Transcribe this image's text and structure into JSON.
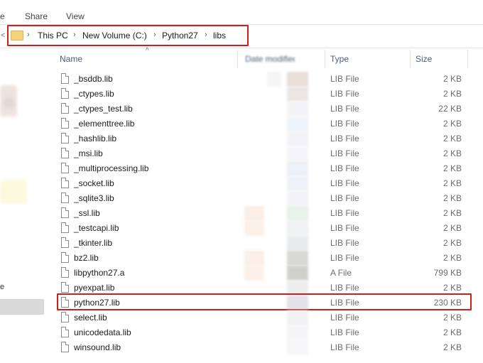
{
  "ribbon": {
    "tab_partial": "e",
    "share": "Share",
    "view": "View"
  },
  "address": {
    "crumbs": [
      "This PC",
      "New Volume (C:)",
      "Python27",
      "libs"
    ],
    "separator": "›",
    "nav_arrow": "<"
  },
  "nav_pane": {
    "partial_label": "e"
  },
  "columns": {
    "name": "Name",
    "date": "Date modified",
    "type": "Type",
    "size": "Size",
    "sort_caret": "^"
  },
  "files": [
    {
      "name": "_bsddb.lib",
      "type": "LIB File",
      "size": "2 KB"
    },
    {
      "name": "_ctypes.lib",
      "type": "LIB File",
      "size": "2 KB"
    },
    {
      "name": "_ctypes_test.lib",
      "type": "LIB File",
      "size": "22 KB"
    },
    {
      "name": "_elementtree.lib",
      "type": "LIB File",
      "size": "2 KB"
    },
    {
      "name": "_hashlib.lib",
      "type": "LIB File",
      "size": "2 KB"
    },
    {
      "name": "_msi.lib",
      "type": "LIB File",
      "size": "2 KB"
    },
    {
      "name": "_multiprocessing.lib",
      "type": "LIB File",
      "size": "2 KB"
    },
    {
      "name": "_socket.lib",
      "type": "LIB File",
      "size": "2 KB"
    },
    {
      "name": "_sqlite3.lib",
      "type": "LIB File",
      "size": "2 KB"
    },
    {
      "name": "_ssl.lib",
      "type": "LIB File",
      "size": "2 KB"
    },
    {
      "name": "_testcapi.lib",
      "type": "LIB File",
      "size": "2 KB"
    },
    {
      "name": "_tkinter.lib",
      "type": "LIB File",
      "size": "2 KB"
    },
    {
      "name": "bz2.lib",
      "type": "LIB File",
      "size": "2 KB"
    },
    {
      "name": "libpython27.a",
      "type": "A File",
      "size": "799 KB"
    },
    {
      "name": "pyexpat.lib",
      "type": "LIB File",
      "size": "2 KB"
    },
    {
      "name": "python27.lib",
      "type": "LIB File",
      "size": "230 KB",
      "highlighted": true
    },
    {
      "name": "select.lib",
      "type": "LIB File",
      "size": "2 KB"
    },
    {
      "name": "unicodedata.lib",
      "type": "LIB File",
      "size": "2 KB"
    },
    {
      "name": "winsound.lib",
      "type": "LIB File",
      "size": "2 KB"
    }
  ],
  "colors": {
    "highlight": "#d01e1e",
    "header_text": "#4c607a",
    "folder": "#f6d27a"
  }
}
